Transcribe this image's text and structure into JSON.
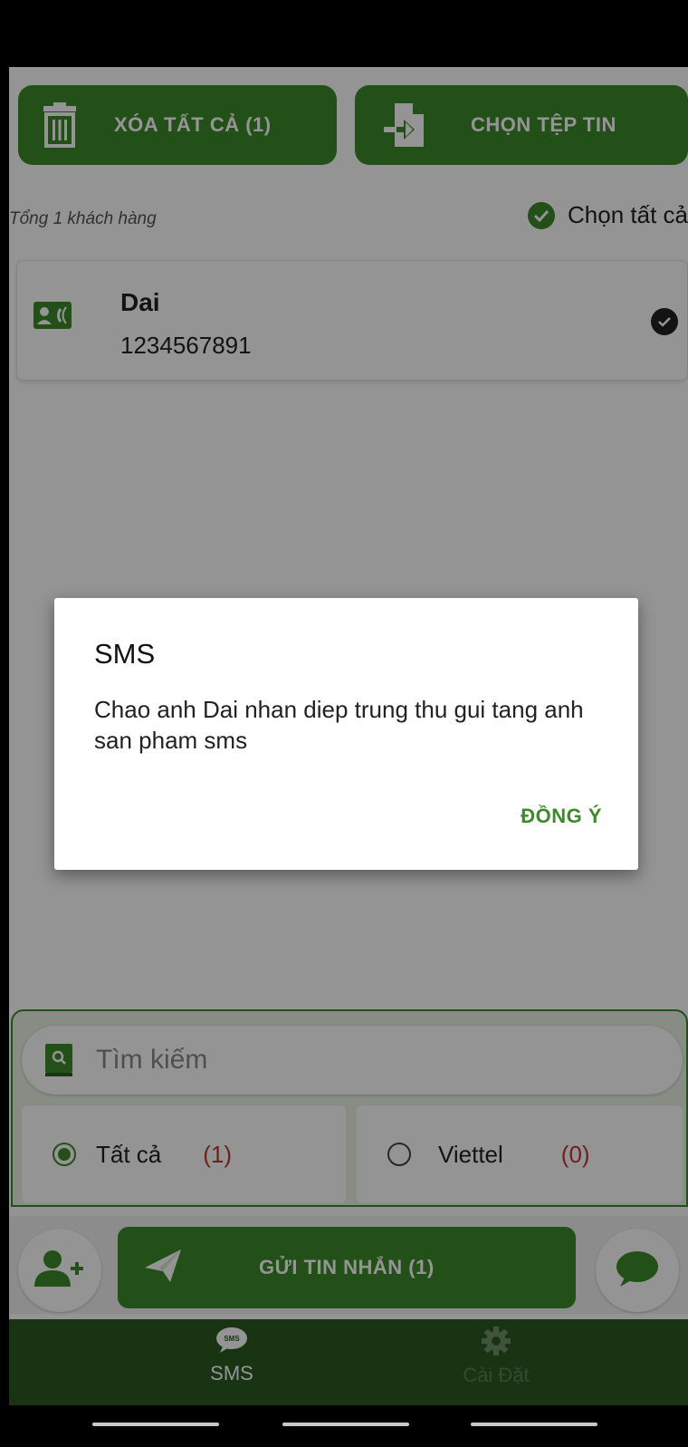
{
  "toolbar": {
    "delete_all_label": "XÓA TẤT CẢ (1)",
    "choose_file_label": "CHỌN TỆP TIN"
  },
  "summary": {
    "total_text": "Tổng 1 khách hàng",
    "select_all_label": "Chọn tất cả"
  },
  "contacts": [
    {
      "name": "Dai",
      "phone": "1234567891",
      "selected": true
    }
  ],
  "search": {
    "placeholder": "Tìm kiếm"
  },
  "filters": [
    {
      "label": "Tất cả",
      "count": "(1)",
      "selected": true
    },
    {
      "label": "Viettel",
      "count": "(0)",
      "selected": false
    }
  ],
  "actions": {
    "send_label": "GỬI TIN NHẮN (1)"
  },
  "bottom_nav": [
    {
      "label": "SMS",
      "icon": "sms-bubble-icon",
      "active": true
    },
    {
      "label": "Cài Đặt",
      "icon": "gear-icon",
      "active": false
    }
  ],
  "dialog": {
    "title": "SMS",
    "message": "Chao anh Dai nhan diep trung thu gui tang anh san pham sms",
    "ok_label": "ĐỒNG Ý"
  },
  "colors": {
    "primary": "#3d8a2c",
    "nav_bg": "#2c5a22",
    "count": "#c0392b"
  }
}
